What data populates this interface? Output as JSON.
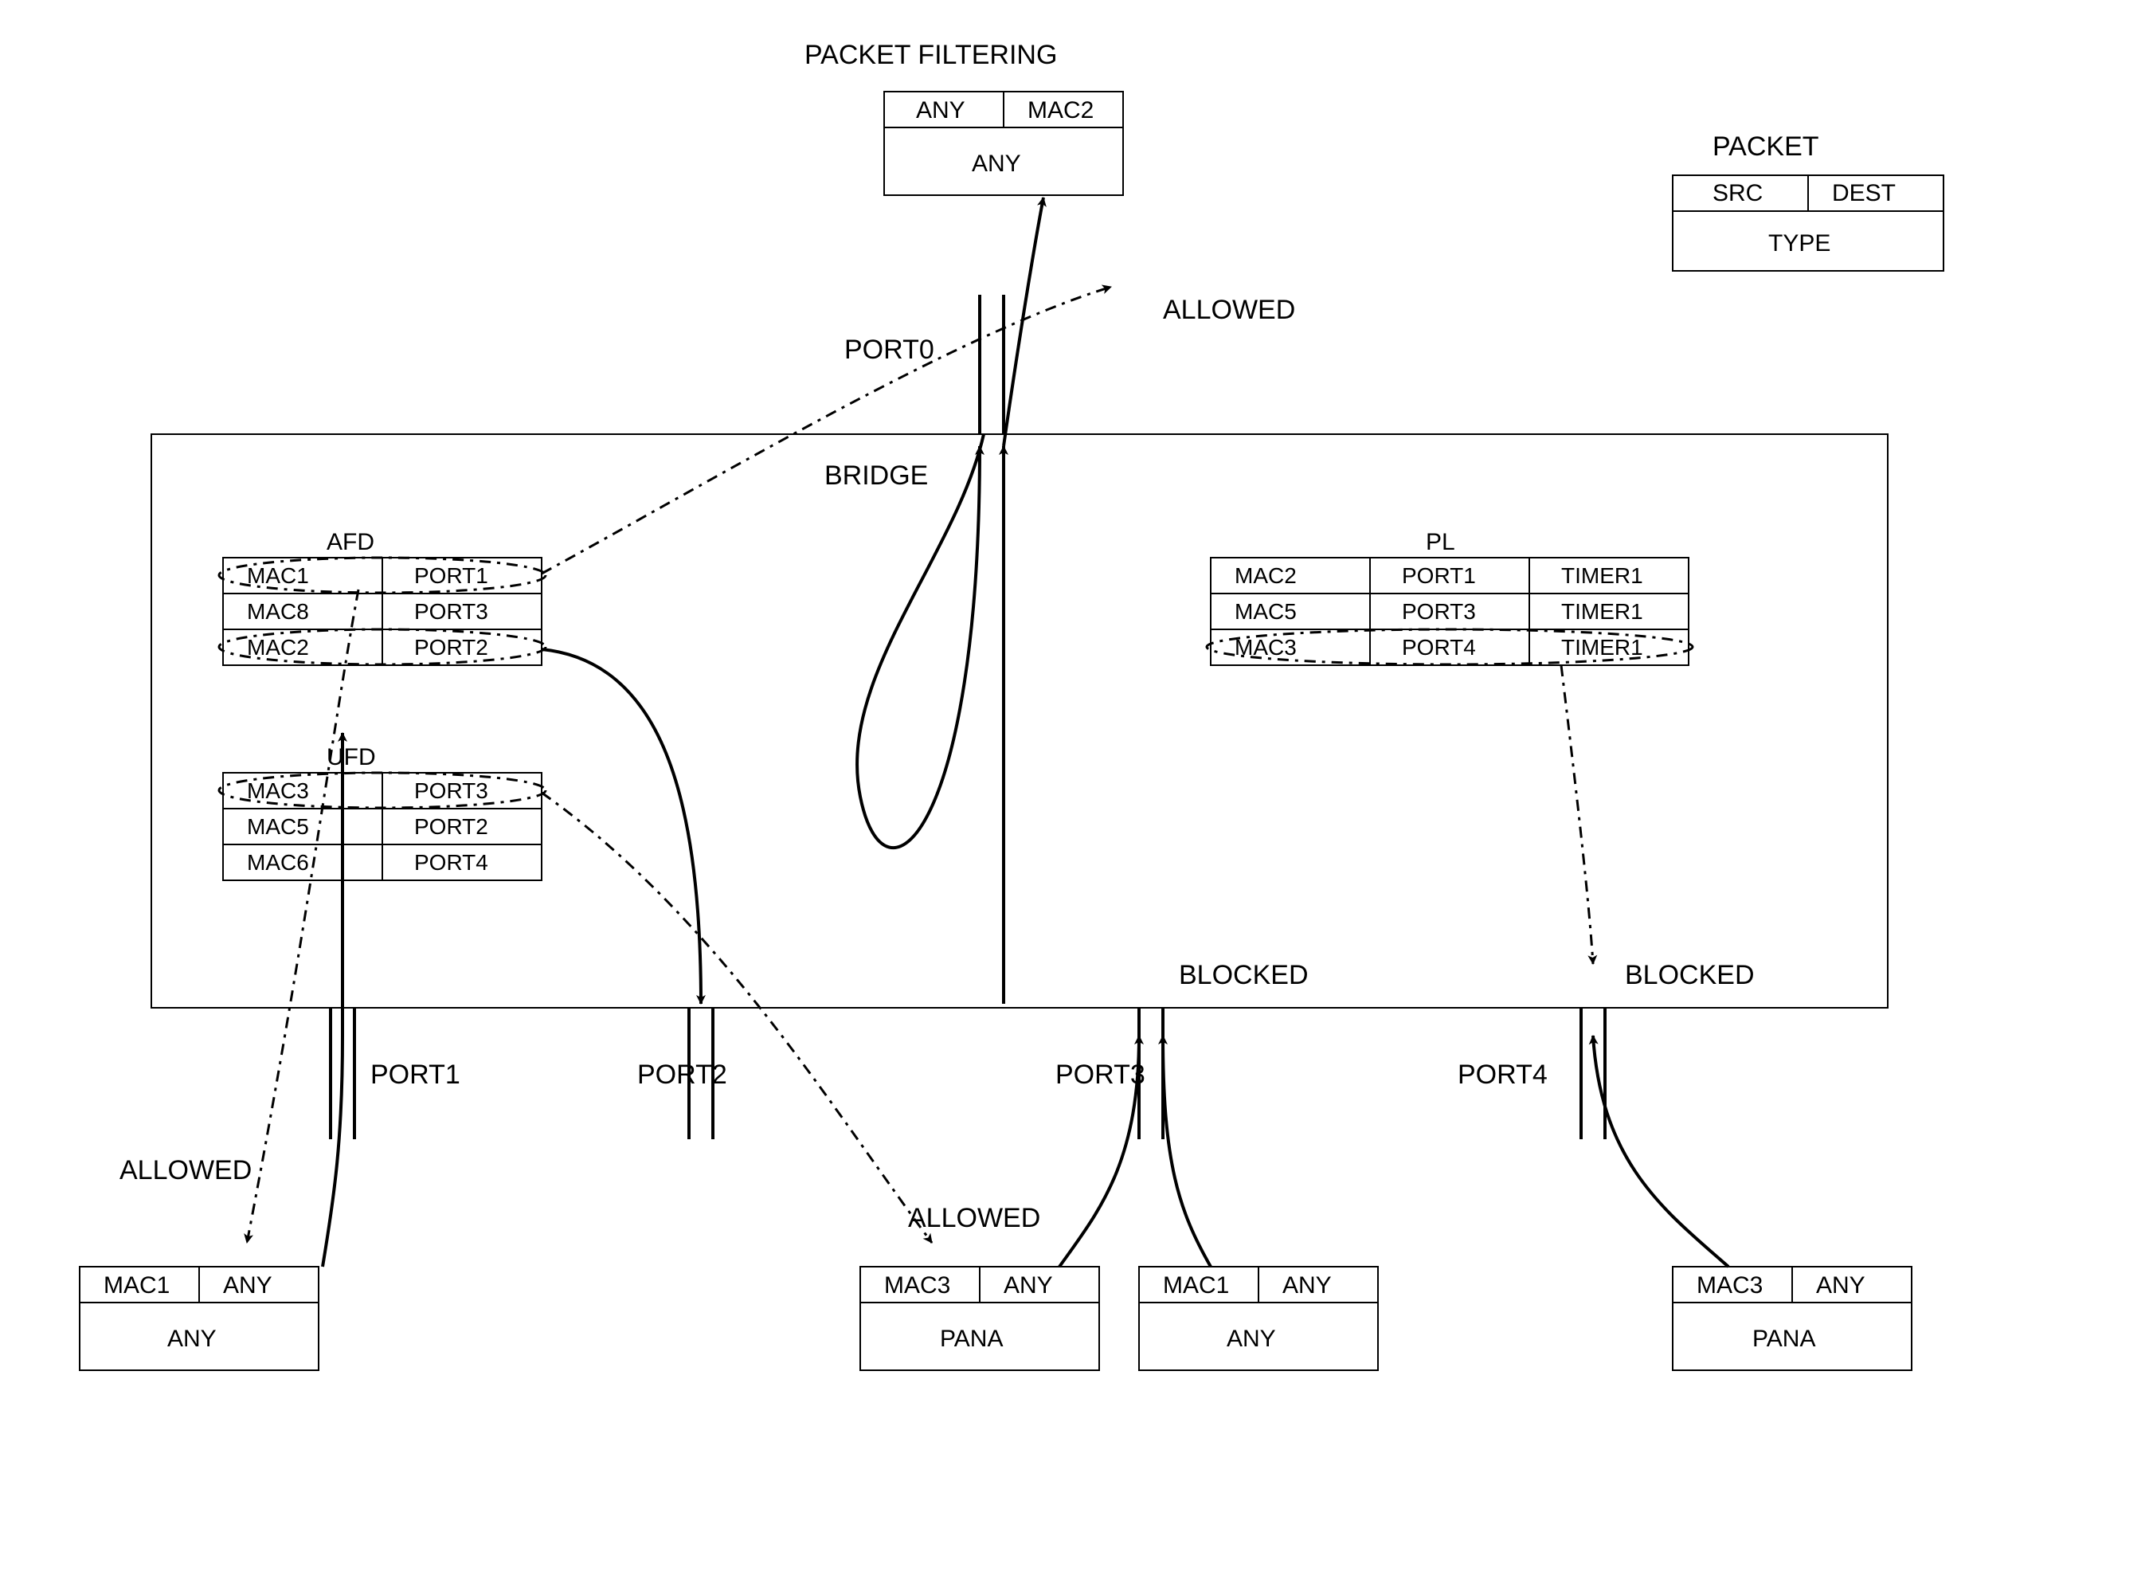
{
  "title": "PACKET FILTERING",
  "legend": {
    "title": "PACKET",
    "src": "SRC",
    "dest": "DEST",
    "type": "TYPE"
  },
  "bridge_label": "BRIDGE",
  "ports": {
    "p0": "PORT0",
    "p1": "PORT1",
    "p2": "PORT2",
    "p3": "PORT3",
    "p4": "PORT4"
  },
  "afd": {
    "title": "AFD",
    "rows": [
      {
        "mac": "MAC1",
        "port": "PORT1"
      },
      {
        "mac": "MAC8",
        "port": "PORT3"
      },
      {
        "mac": "MAC2",
        "port": "PORT2"
      }
    ]
  },
  "ufd": {
    "title": "UFD",
    "rows": [
      {
        "mac": "MAC3",
        "port": "PORT3"
      },
      {
        "mac": "MAC5",
        "port": "PORT2"
      },
      {
        "mac": "MAC6",
        "port": "PORT4"
      }
    ]
  },
  "pl": {
    "title": "PL",
    "rows": [
      {
        "mac": "MAC2",
        "port": "PORT1",
        "timer": "TIMER1"
      },
      {
        "mac": "MAC5",
        "port": "PORT3",
        "timer": "TIMER1"
      },
      {
        "mac": "MAC3",
        "port": "PORT4",
        "timer": "TIMER1"
      }
    ]
  },
  "packets": {
    "top": {
      "src": "ANY",
      "dest": "MAC2",
      "type": "ANY"
    },
    "p1": {
      "src": "MAC1",
      "dest": "ANY",
      "type": "ANY"
    },
    "p3a": {
      "src": "MAC3",
      "dest": "ANY",
      "type": "PANA"
    },
    "p3b": {
      "src": "MAC1",
      "dest": "ANY",
      "type": "ANY"
    },
    "p4": {
      "src": "MAC3",
      "dest": "ANY",
      "type": "PANA"
    }
  },
  "labels": {
    "allowed": "ALLOWED",
    "blocked": "BLOCKED"
  }
}
